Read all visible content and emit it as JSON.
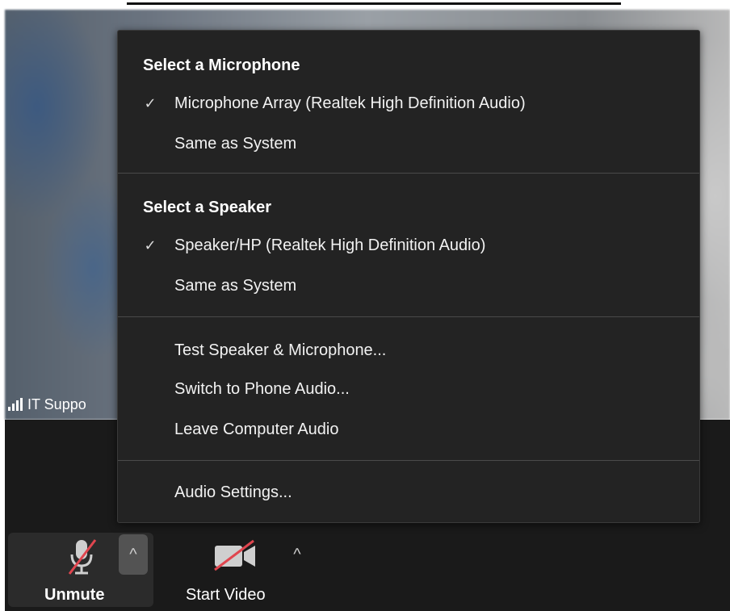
{
  "colors": {
    "menu_bg": "#232323",
    "toolbar_bg": "#1a1a1a",
    "mute_slash": "#e0464f",
    "text": "#f2f2f2"
  },
  "video": {
    "participant_name": "IT Suppo",
    "signal_icon": "signal-bars-icon"
  },
  "menu": {
    "microphone_heading": "Select a Microphone",
    "microphone_items": [
      {
        "label": "Microphone Array (Realtek High Definition Audio)",
        "selected": true
      },
      {
        "label": "Same as System",
        "selected": false
      }
    ],
    "speaker_heading": "Select a Speaker",
    "speaker_items": [
      {
        "label": "Speaker/HP (Realtek High Definition Audio)",
        "selected": true
      },
      {
        "label": "Same as System",
        "selected": false
      }
    ],
    "actions": [
      {
        "label": "Test Speaker & Microphone..."
      },
      {
        "label": "Switch to Phone Audio..."
      },
      {
        "label": "Leave Computer Audio"
      }
    ],
    "settings": {
      "label": "Audio Settings..."
    },
    "check_glyph": "✓"
  },
  "toolbar": {
    "unmute_label": "Unmute",
    "start_video_label": "Start Video",
    "caret_glyph": "^"
  }
}
